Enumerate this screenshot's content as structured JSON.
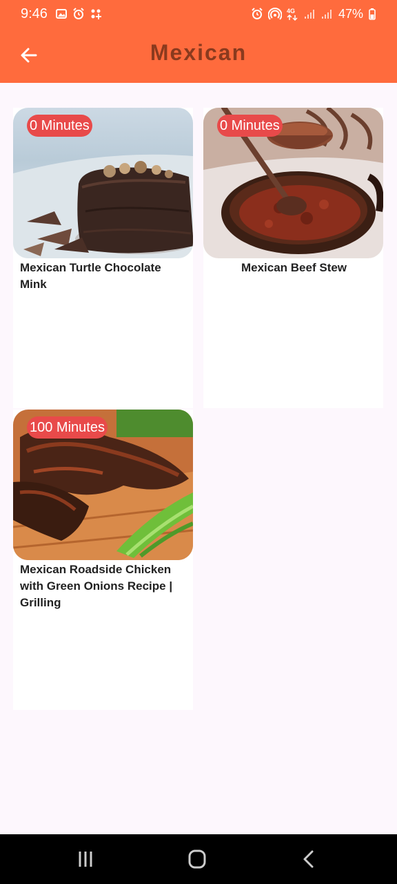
{
  "status_bar": {
    "time": "9:46",
    "left_icons": [
      "image-icon",
      "alarm-icon",
      "grid-icon"
    ],
    "right_icons": [
      "alarm-icon",
      "hotspot-icon",
      "4g-icon",
      "signal-icon",
      "signal-icon"
    ],
    "battery": "47%"
  },
  "appbar": {
    "title": "Mexican",
    "back_icon": "arrow-left-icon"
  },
  "recipes": [
    {
      "title": "Mexican Turtle Chocolate Mink",
      "duration": "0 Minutes",
      "image": "chocolate-cake"
    },
    {
      "title": "Mexican Beef Stew",
      "duration": "0 Minutes",
      "image": "beef-stew"
    },
    {
      "title": "Mexican Roadside Chicken with Green Onions Recipe | Grilling",
      "duration": "100 Minutes",
      "image": "grilled-chicken"
    }
  ],
  "nav": {
    "recents_icon": "recents-icon",
    "home_icon": "home-icon",
    "back_icon": "back-icon"
  },
  "colors": {
    "appbar": "#FF6B3D",
    "title_text": "#8A3A1E",
    "badge": "#E84A4A",
    "background": "#FDF7FD"
  }
}
